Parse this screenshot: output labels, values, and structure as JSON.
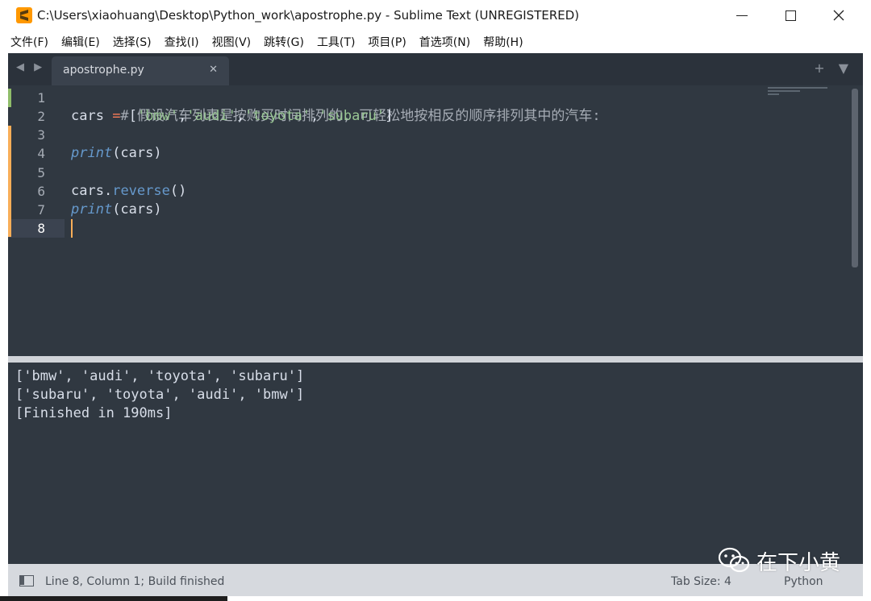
{
  "window": {
    "title": "C:\\Users\\xiaohuang\\Desktop\\Python_work\\apostrophe.py - Sublime Text (UNREGISTERED)",
    "controls": {
      "minimize_icon": "minimize-icon",
      "maximize_icon": "maximize-icon",
      "close_icon": "close-icon"
    }
  },
  "menu": {
    "items": [
      "文件(F)",
      "编辑(E)",
      "选择(S)",
      "查找(I)",
      "视图(V)",
      "跳转(G)",
      "工具(T)",
      "项目(P)",
      "首选项(N)",
      "帮助(H)"
    ]
  },
  "tabs": {
    "active_label": "apostrophe.py",
    "close_glyph": "✕",
    "nav_glyphs": "◀ ▶",
    "right_glyphs": "+ ▼"
  },
  "editor": {
    "line_numbers": [
      "1",
      "2",
      "3",
      "4",
      "5",
      "6",
      "7",
      "8"
    ],
    "current_line": "8",
    "lines": {
      "l1": {
        "comment": "# 假设汽车列表是按购买时间排列的, 可轻松地按相反的顺序排列其中的汽车:"
      },
      "l2": {
        "name": "cars",
        "op": "=",
        "open": "[",
        "s1": "'bmw'",
        "comma1": ",",
        "s2": "'audi'",
        "comma2": ",",
        "s3": "'toyota'",
        "comma3": ",",
        "s4": "'subaru'",
        "close": "]"
      },
      "l4": {
        "fn": "print",
        "args": "(cars)"
      },
      "l6": {
        "name": "cars",
        "dot": ".",
        "method": "reverse",
        "args": "()"
      },
      "l7": {
        "fn": "print",
        "args": "(cars)"
      }
    }
  },
  "output": {
    "lines": [
      "['bmw', 'audi', 'toyota', 'subaru']",
      "['subaru', 'toyota', 'audi', 'bmw']",
      "[Finished in 190ms]"
    ]
  },
  "status": {
    "position": "Line 8, Column 1; Build finished",
    "tab_size": "Tab Size: 4",
    "syntax": "Python"
  },
  "watermark": {
    "text": "在下小黄",
    "icon": "wechat-icon"
  },
  "colors": {
    "editor_bg": "#303841",
    "frame_bg": "#2b323b",
    "string": "#99c794",
    "operator": "#f97b58",
    "function": "#6699cc",
    "modified_marker": "#f9ae58",
    "added_marker": "#8fbd6a",
    "app_icon": "#ff9800"
  }
}
